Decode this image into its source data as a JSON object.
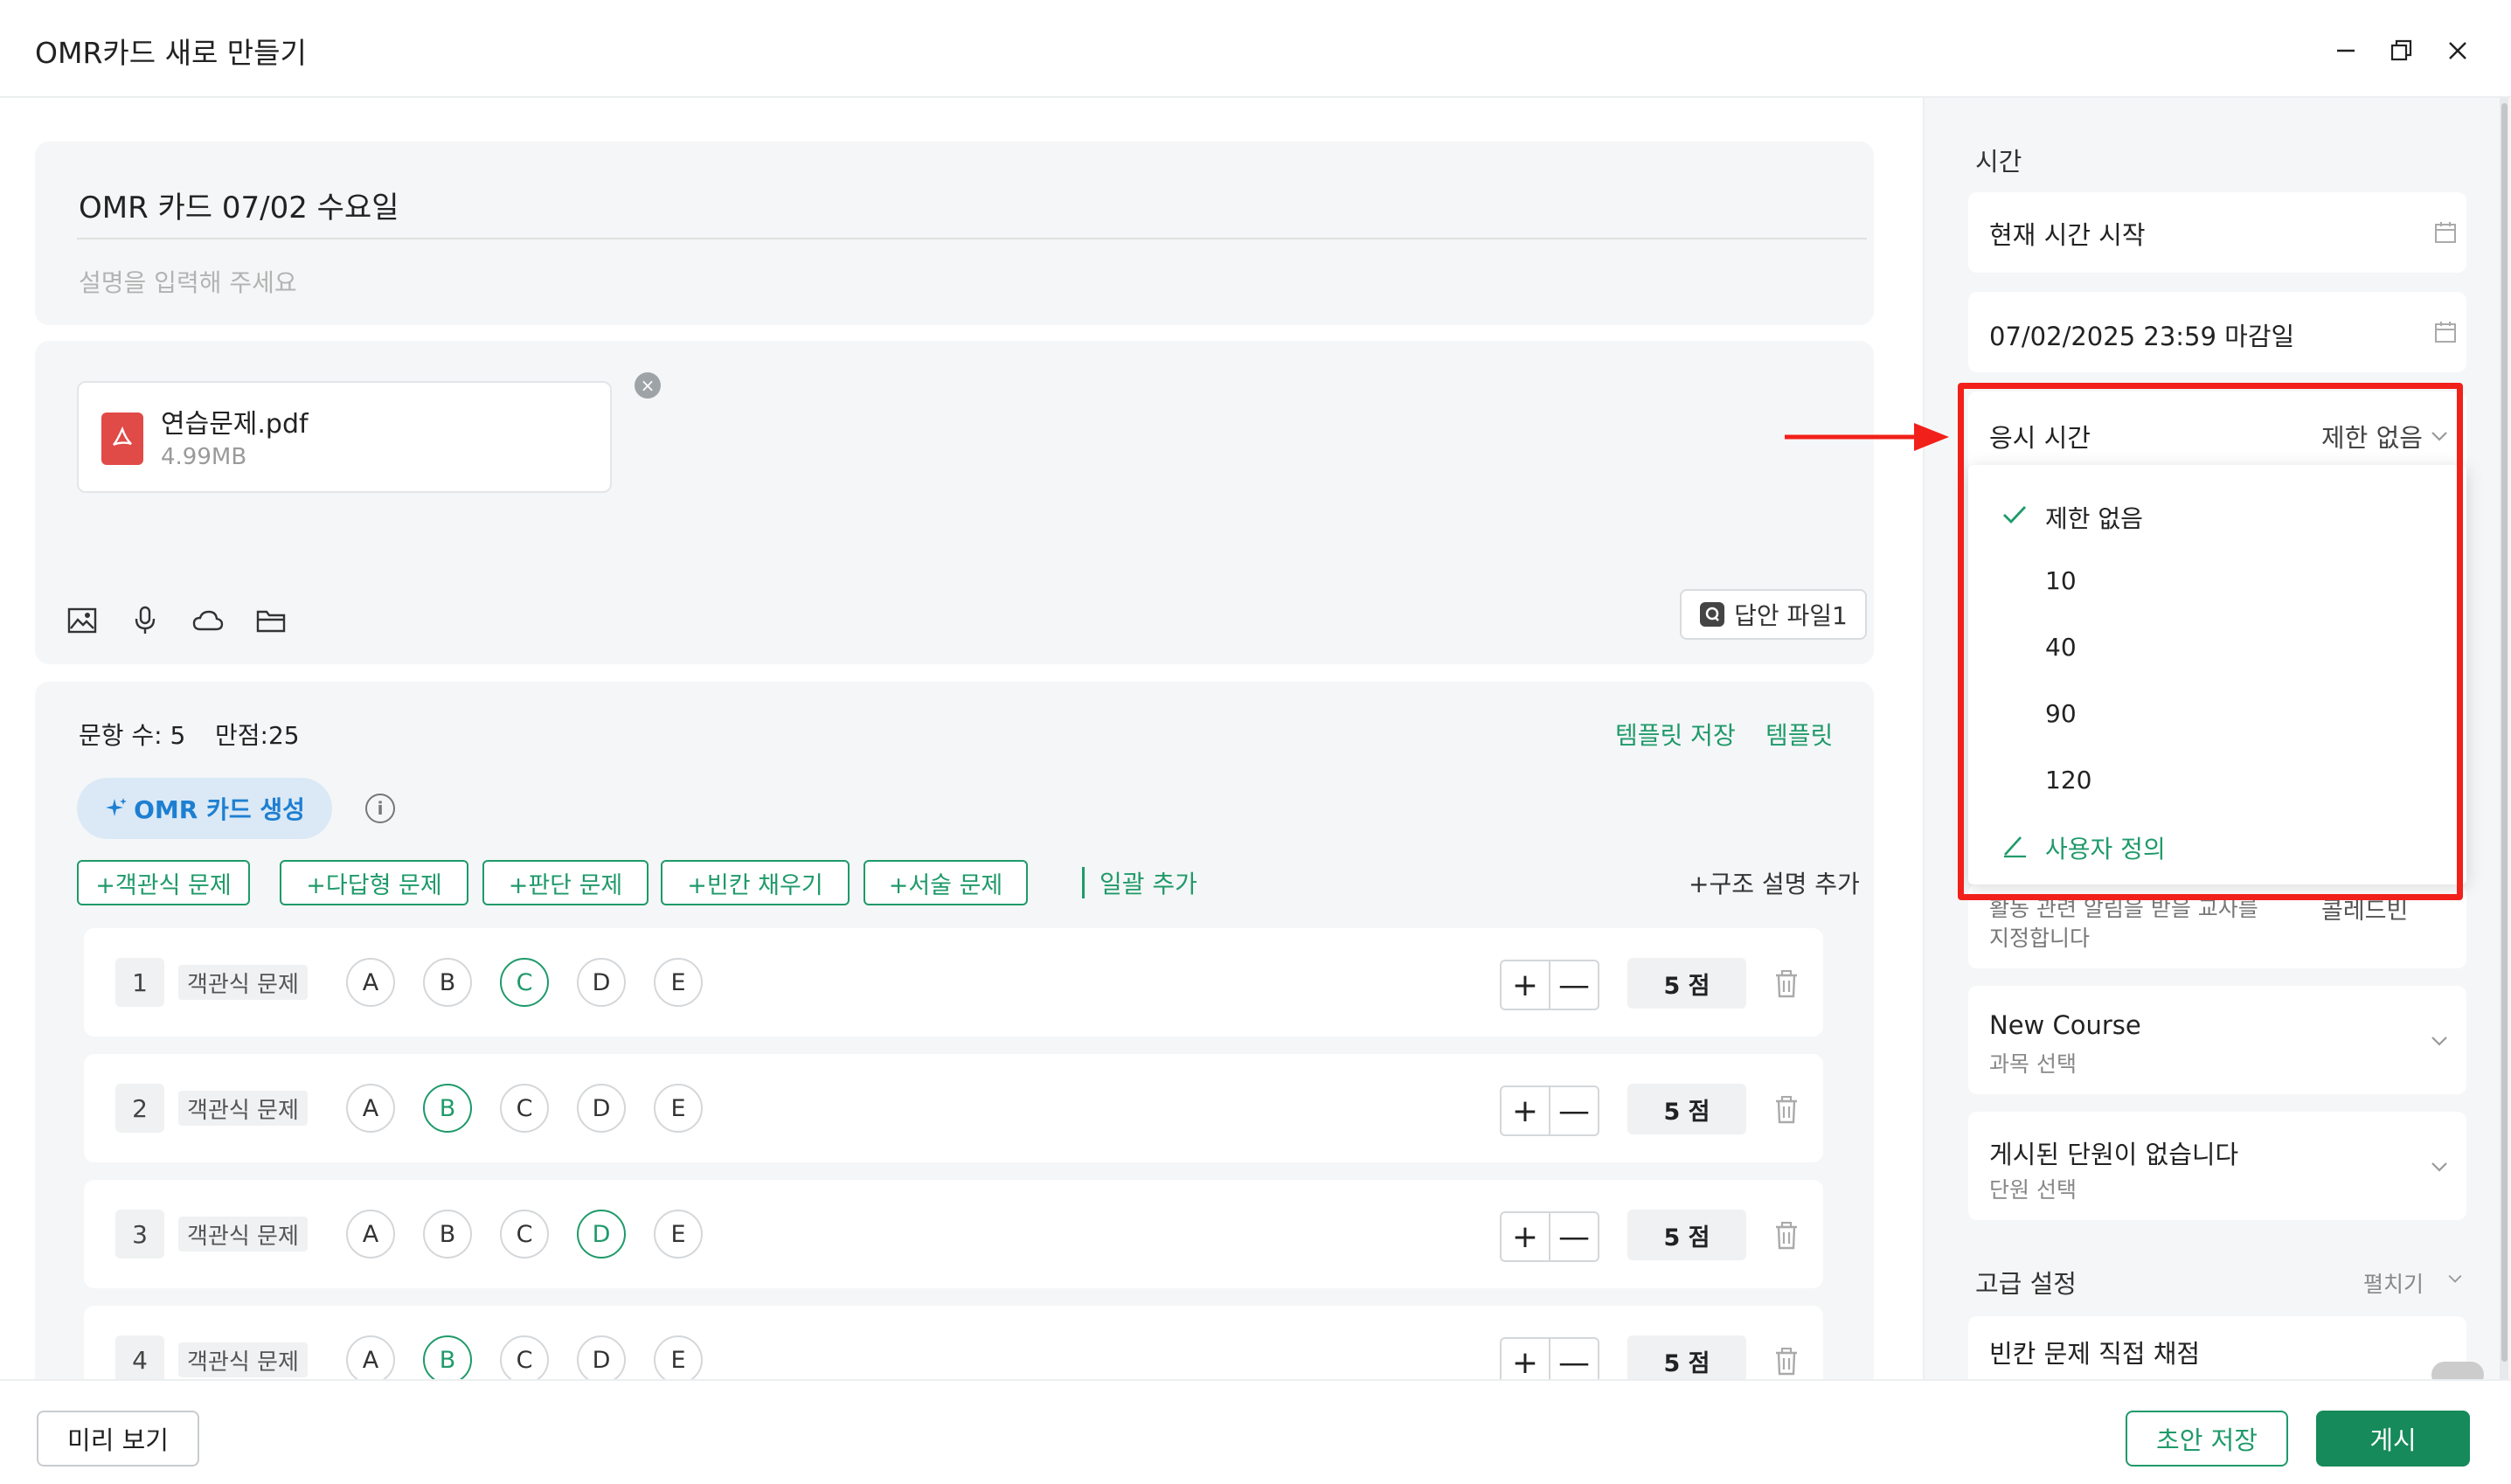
{
  "window": {
    "title": "OMR카드 새로 만들기"
  },
  "header": {
    "title": "OMR 카드 07/02 수요일",
    "description_placeholder": "설명을 입력해 주세요"
  },
  "attachment": {
    "name": "연습문제.pdf",
    "size": "4.99MB",
    "icon": "pdf-icon"
  },
  "toolbar": {
    "icons": [
      "image-icon",
      "microphone-icon",
      "cloud-icon",
      "folder-icon"
    ],
    "answer_file_label": "답안 파일1"
  },
  "questions_section": {
    "count_label": "문항 수: 5",
    "total_label": "만점:25",
    "save_template": "템플릿 저장",
    "template": "템플릿",
    "generate_label": "OMR 카드 생성",
    "add_buttons": [
      "+객관식 문제",
      "+다답형 문제",
      "+판단 문제",
      "+빈칸 채우기",
      "+서술 문제"
    ],
    "batch_add": "일괄 추가",
    "add_structure": "+구조 설명 추가"
  },
  "questions": [
    {
      "num": "1",
      "type": "객관식 문제",
      "options": [
        "A",
        "B",
        "C",
        "D",
        "E"
      ],
      "selected": "C",
      "score": "5 점"
    },
    {
      "num": "2",
      "type": "객관식 문제",
      "options": [
        "A",
        "B",
        "C",
        "D",
        "E"
      ],
      "selected": "B",
      "score": "5 점"
    },
    {
      "num": "3",
      "type": "객관식 문제",
      "options": [
        "A",
        "B",
        "C",
        "D",
        "E"
      ],
      "selected": "D",
      "score": "5 점"
    },
    {
      "num": "4",
      "type": "객관식 문제",
      "options": [
        "A",
        "B",
        "C",
        "D",
        "E"
      ],
      "selected": "B",
      "score": "5 점"
    }
  ],
  "stepper": {
    "plus": "+",
    "minus": "—"
  },
  "right": {
    "time_label": "시간",
    "start_time": "현재 시간 시작",
    "deadline": "07/02/2025 23:59 마감일",
    "duration_label": "응시 시간",
    "duration_value": "제한 없음",
    "duration_options": [
      {
        "label": "제한 없음",
        "checked": true
      },
      {
        "label": "10"
      },
      {
        "label": "40"
      },
      {
        "label": "90"
      },
      {
        "label": "120"
      }
    ],
    "custom_label": "사용자 정의",
    "partial_text_1": "활동 관련 알림을 받을 교사를",
    "partial_text_2": "지정합니다",
    "partial_right": "콜레드빈",
    "course_name": "New Course",
    "course_sub": "과목 선택",
    "unit_name": "게시된 단원이 없습니다",
    "unit_sub": "단원 선택",
    "advanced_label": "고급 설정",
    "expand_label": "펼치기",
    "blank_grading": "빈칸 문제 직접 채점"
  },
  "footer": {
    "preview": "미리 보기",
    "draft": "초안 저장",
    "post": "게시"
  },
  "colors": {
    "accent": "#1f9a6a",
    "highlight_box": "#f2201a",
    "pdf": "#e04a47"
  }
}
